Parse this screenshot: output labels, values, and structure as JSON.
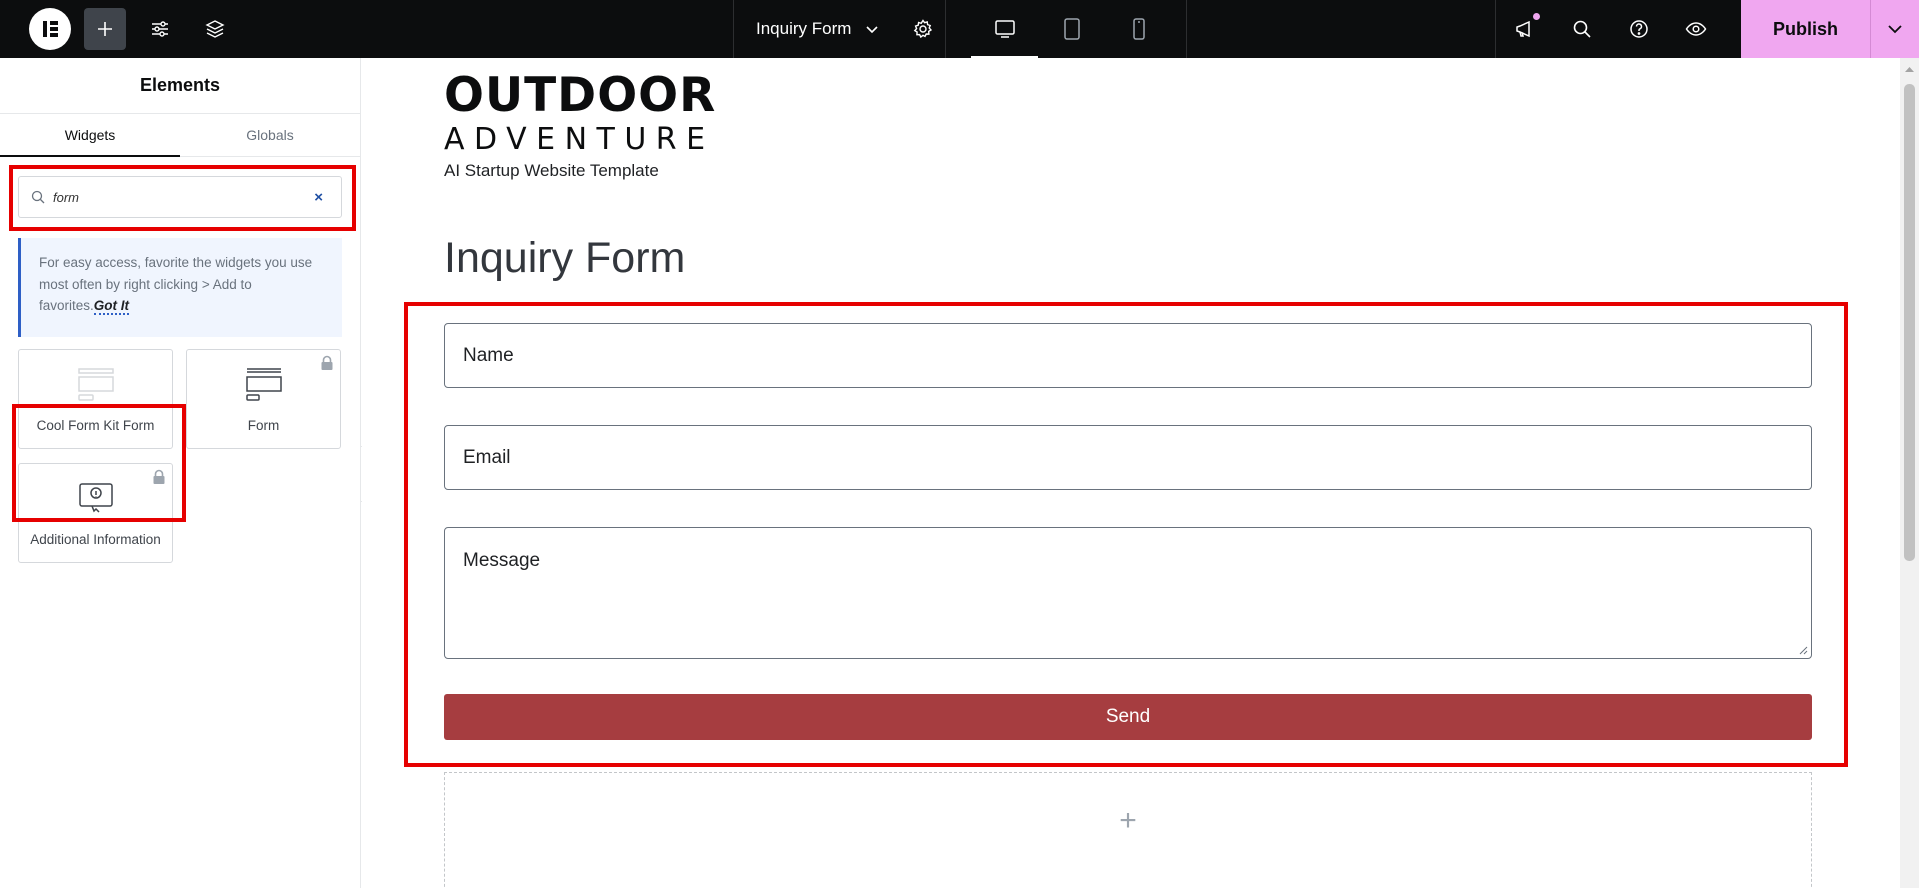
{
  "topbar": {
    "document_title": "Inquiry Form",
    "publish_label": "Publish",
    "accent_color": "#f0a7f0"
  },
  "panel": {
    "title": "Elements",
    "tabs": [
      {
        "label": "Widgets",
        "active": true
      },
      {
        "label": "Globals",
        "active": false
      }
    ],
    "search": {
      "value": "form"
    },
    "tip": {
      "text": "For easy access, favorite the widgets you use most often by right clicking > Add to favorites.",
      "action": "Got It"
    },
    "widgets": [
      {
        "label": "Cool Form Kit Form",
        "icon": "form-icon",
        "locked": false
      },
      {
        "label": "Form",
        "icon": "form-icon",
        "locked": true
      },
      {
        "label": "Additional Information",
        "icon": "info-tooltip-icon",
        "locked": true
      }
    ]
  },
  "canvas": {
    "brand": {
      "line1": "OUTDOOR",
      "line2": "ADVENTURE",
      "tagline": "AI Startup Website Template"
    },
    "heading": "Inquiry Form",
    "fields": {
      "name": "Name",
      "email": "Email",
      "message": "Message"
    },
    "submit_label": "Send",
    "submit_color": "#a63d40"
  }
}
